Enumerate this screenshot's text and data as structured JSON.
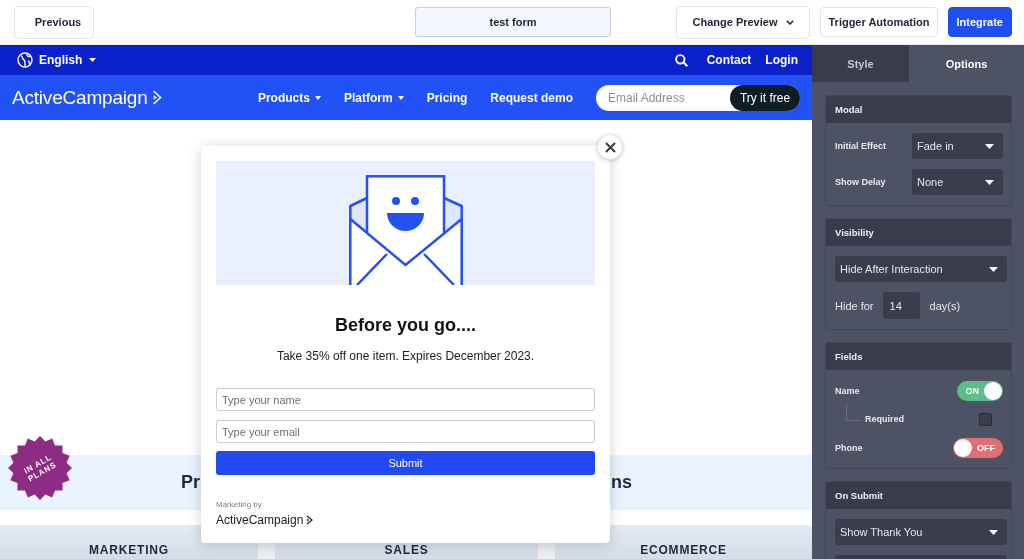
{
  "toolbar": {
    "previous": "Previous",
    "form_name": "test form",
    "change_preview": "Change Preview",
    "trigger_automation": "Trigger Automation",
    "integrate": "Integrate"
  },
  "site": {
    "utility_bar": {
      "language": "English",
      "links": [
        "Contact",
        "Login"
      ]
    },
    "nav": {
      "logo": "ActiveCampaign",
      "items": [
        {
          "label": "Products",
          "dropdown": true
        },
        {
          "label": "Platform",
          "dropdown": true
        },
        {
          "label": "Pricing",
          "dropdown": false
        },
        {
          "label": "Request demo",
          "dropdown": false
        }
      ],
      "email_placeholder": "Email Address",
      "cta": "Try it free"
    },
    "badge": "IN ALL PLANS",
    "heading_fragments": [
      "Pr",
      "ns"
    ],
    "plan_columns": [
      "MARKETING",
      "SALES",
      "ECOMMERCE"
    ]
  },
  "modal": {
    "title": "Before you go....",
    "text": "Take 35% off one item. Expires December 2023.",
    "fields": [
      {
        "placeholder": "Type your name"
      },
      {
        "placeholder": "Type your email"
      }
    ],
    "submit": "Submit",
    "footer_caption": "Marketing by",
    "footer_logo": "ActiveCampaign"
  },
  "panel": {
    "tabs": [
      {
        "label": "Style",
        "selected": false
      },
      {
        "label": "Options",
        "selected": true
      }
    ],
    "sections": [
      {
        "title": "Modal",
        "rows": [
          {
            "kind": "select",
            "label": "Initial Effect",
            "value": "Fade in"
          },
          {
            "kind": "select",
            "label": "Show Delay",
            "value": "None"
          }
        ]
      },
      {
        "title": "Visibility",
        "rows": [
          {
            "kind": "wide_select",
            "value": "Hide After Interaction"
          },
          {
            "kind": "number",
            "label": "Hide for",
            "value": "14",
            "unit": "day(s)"
          }
        ]
      },
      {
        "title": "Fields",
        "rows": [
          {
            "kind": "toggle",
            "label": "Name",
            "on": true,
            "state_label": "ON",
            "children": [
              {
                "kind": "checkbox",
                "label": "Required",
                "checked": false
              }
            ]
          },
          {
            "kind": "toggle",
            "label": "Phone",
            "on": false,
            "state_label": "OFF"
          }
        ]
      },
      {
        "title": "On Submit",
        "rows": [
          {
            "kind": "wide_select",
            "value": "Show Thank You"
          },
          {
            "kind": "wide_select"
          }
        ]
      }
    ]
  }
}
